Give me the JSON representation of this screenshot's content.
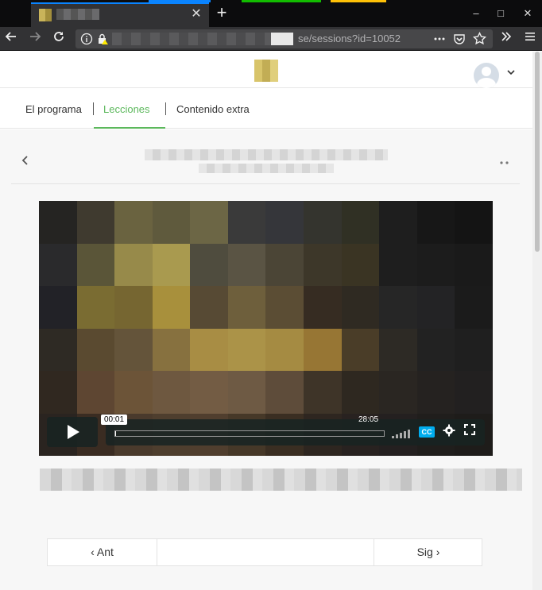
{
  "browser": {
    "new_tab_symbol": "+",
    "close_tab_symbol": "✕",
    "url_visible_text": "se/sessions?id=10052",
    "window_controls": [
      "–",
      "□",
      "✕"
    ],
    "icons": [
      "back-icon",
      "forward-icon",
      "reload-icon",
      "info-icon",
      "lock-warning-icon",
      "bookmark-star-icon",
      "pocket-icon",
      "overflow-icon",
      "menu-icon"
    ]
  },
  "header": {
    "user_menu_chevron": "⌄"
  },
  "tabs": [
    {
      "label": "El programa",
      "active": false
    },
    {
      "label": "Lecciones",
      "active": true
    },
    {
      "label": "Contenido extra",
      "active": false
    }
  ],
  "colors": {
    "accent": "#5cb85c",
    "cc_badge": "#00adef",
    "browser_tab_accent": "#0a84ff"
  },
  "player": {
    "current_time": "00:01",
    "duration": "28:05",
    "progress_fraction": 0.0006,
    "cc_label": "CC"
  },
  "pager": {
    "prev_label": "Ant",
    "next_label": "Sig"
  }
}
